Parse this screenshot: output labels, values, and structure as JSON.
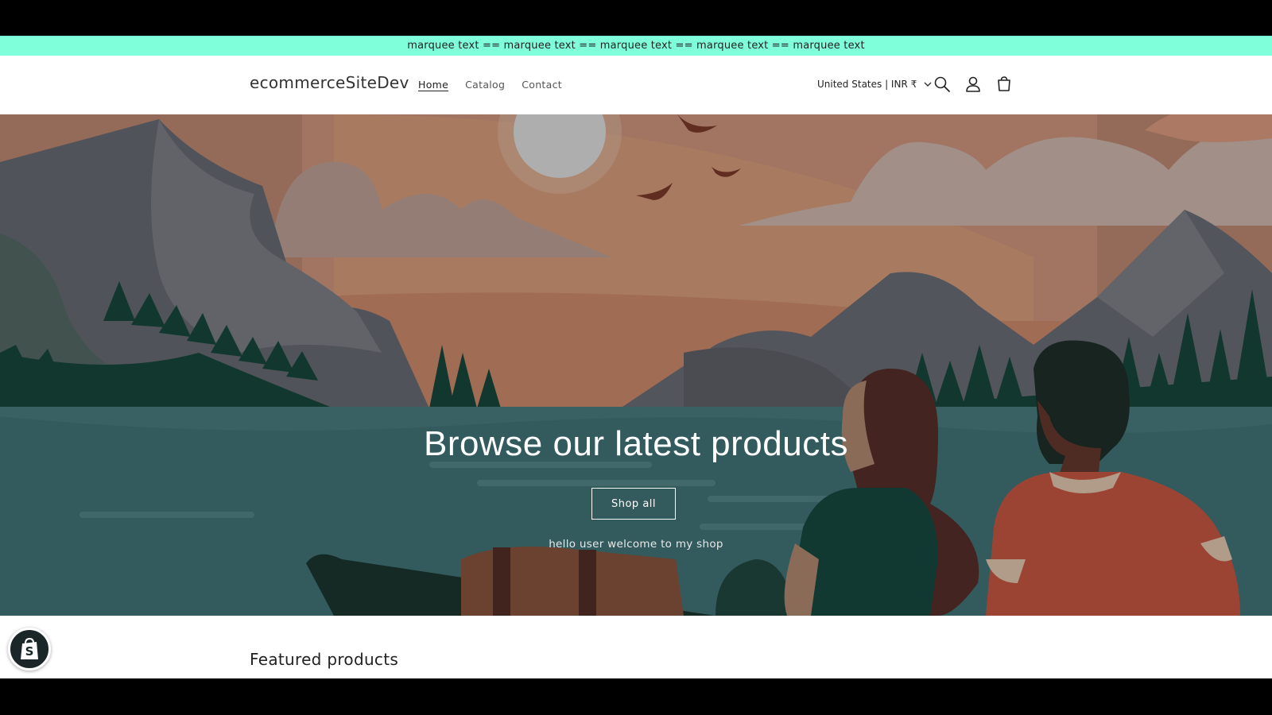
{
  "announcement": {
    "text": "marquee text == marquee text == marquee text == marquee text == marquee text"
  },
  "header": {
    "logo": "ecommerceSiteDev",
    "nav": [
      {
        "label": "Home",
        "active": true
      },
      {
        "label": "Catalog",
        "active": false
      },
      {
        "label": "Contact",
        "active": false
      }
    ],
    "country_selector": "United States | INR ₹",
    "icons": [
      "search-icon",
      "account-icon",
      "cart-icon"
    ]
  },
  "hero": {
    "title": "Browse our latest products",
    "button_label": "Shop all",
    "subtitle": "hello user welcome to my shop"
  },
  "featured": {
    "title": "Featured products"
  },
  "floating": {
    "icon": "shopify-bag-icon"
  },
  "colors": {
    "announcement_bg": "#80ffdb",
    "hero_water": "#3f6d70",
    "hero_sky": "#b07f66"
  }
}
